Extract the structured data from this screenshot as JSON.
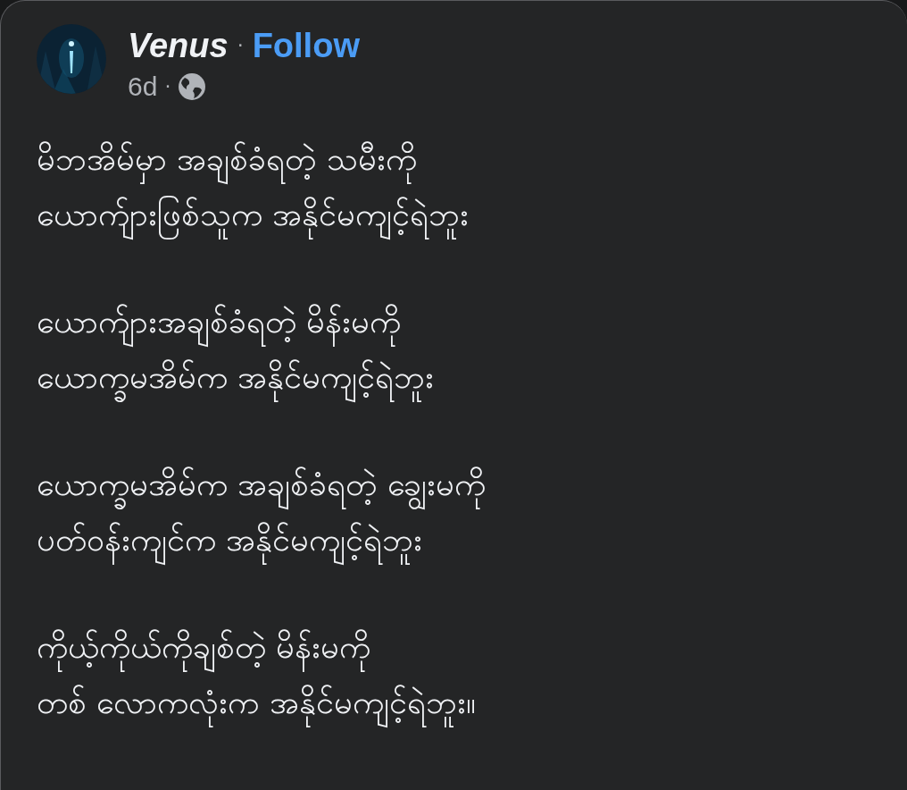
{
  "post": {
    "author": "Venus",
    "separator": "·",
    "follow": "Follow",
    "time": "6d",
    "time_separator": "·",
    "paragraphs": [
      "မိဘအိမ်မှာ အချစ်ခံရတဲ့ သမီးကို\nယောက်ျားဖြစ်သူက အနိုင်မကျင့်ရဲဘူး",
      "ယောက်ျားအချစ်ခံရတဲ့ မိန်းမကို\nယောက္ခမအိမ်က အနိုင်မကျင့်ရဲဘူး",
      "ယောက္ခမအိမ်က အချစ်ခံရတဲ့ ချွေးမကို\nပတ်ဝန်းကျင်က အနိုင်မကျင့်ရဲဘူး",
      "ကိုယ့်ကိုယ်ကိုချစ်တဲ့ မိန်းမကို\nတစ် လောကလုံးက အနိုင်မကျင့်ရဲဘူး။"
    ]
  }
}
